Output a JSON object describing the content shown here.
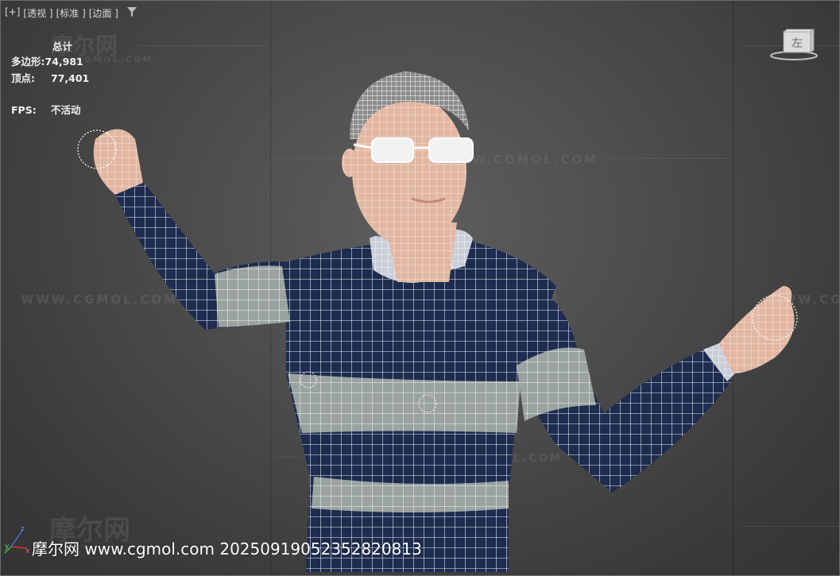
{
  "viewport": {
    "labels": [
      "[+]",
      "[透视 ]",
      "[标准 ]",
      "[边面 ]"
    ],
    "filter_icon": "filter-icon"
  },
  "stats": {
    "header": "总计",
    "polygons_label": "多边形:",
    "polygons_value": "74,981",
    "vertices_label": "顶点:",
    "vertices_value": "77,401",
    "fps_label": "FPS:",
    "fps_value": "不活动"
  },
  "viewcube": {
    "face_label": "左"
  },
  "watermarks": {
    "logo": "摩尔网",
    "logo_sub": "CGMOL.COM",
    "url_text": "WWW.CGMOL.COM",
    "bottom": "摩尔网 www.cgmol.com 20250919052352820813"
  },
  "axis": {
    "z": "z",
    "x": "x",
    "y": "y"
  },
  "colors": {
    "sweater_navy": "#1d2c4f",
    "sweater_stripe": "#9aa3a0",
    "skin": "#e2b7a2",
    "wire": "#ffffff",
    "axis_x": "#d63a3a",
    "axis_y": "#3fbf3f",
    "axis_z": "#3f6fe0"
  }
}
